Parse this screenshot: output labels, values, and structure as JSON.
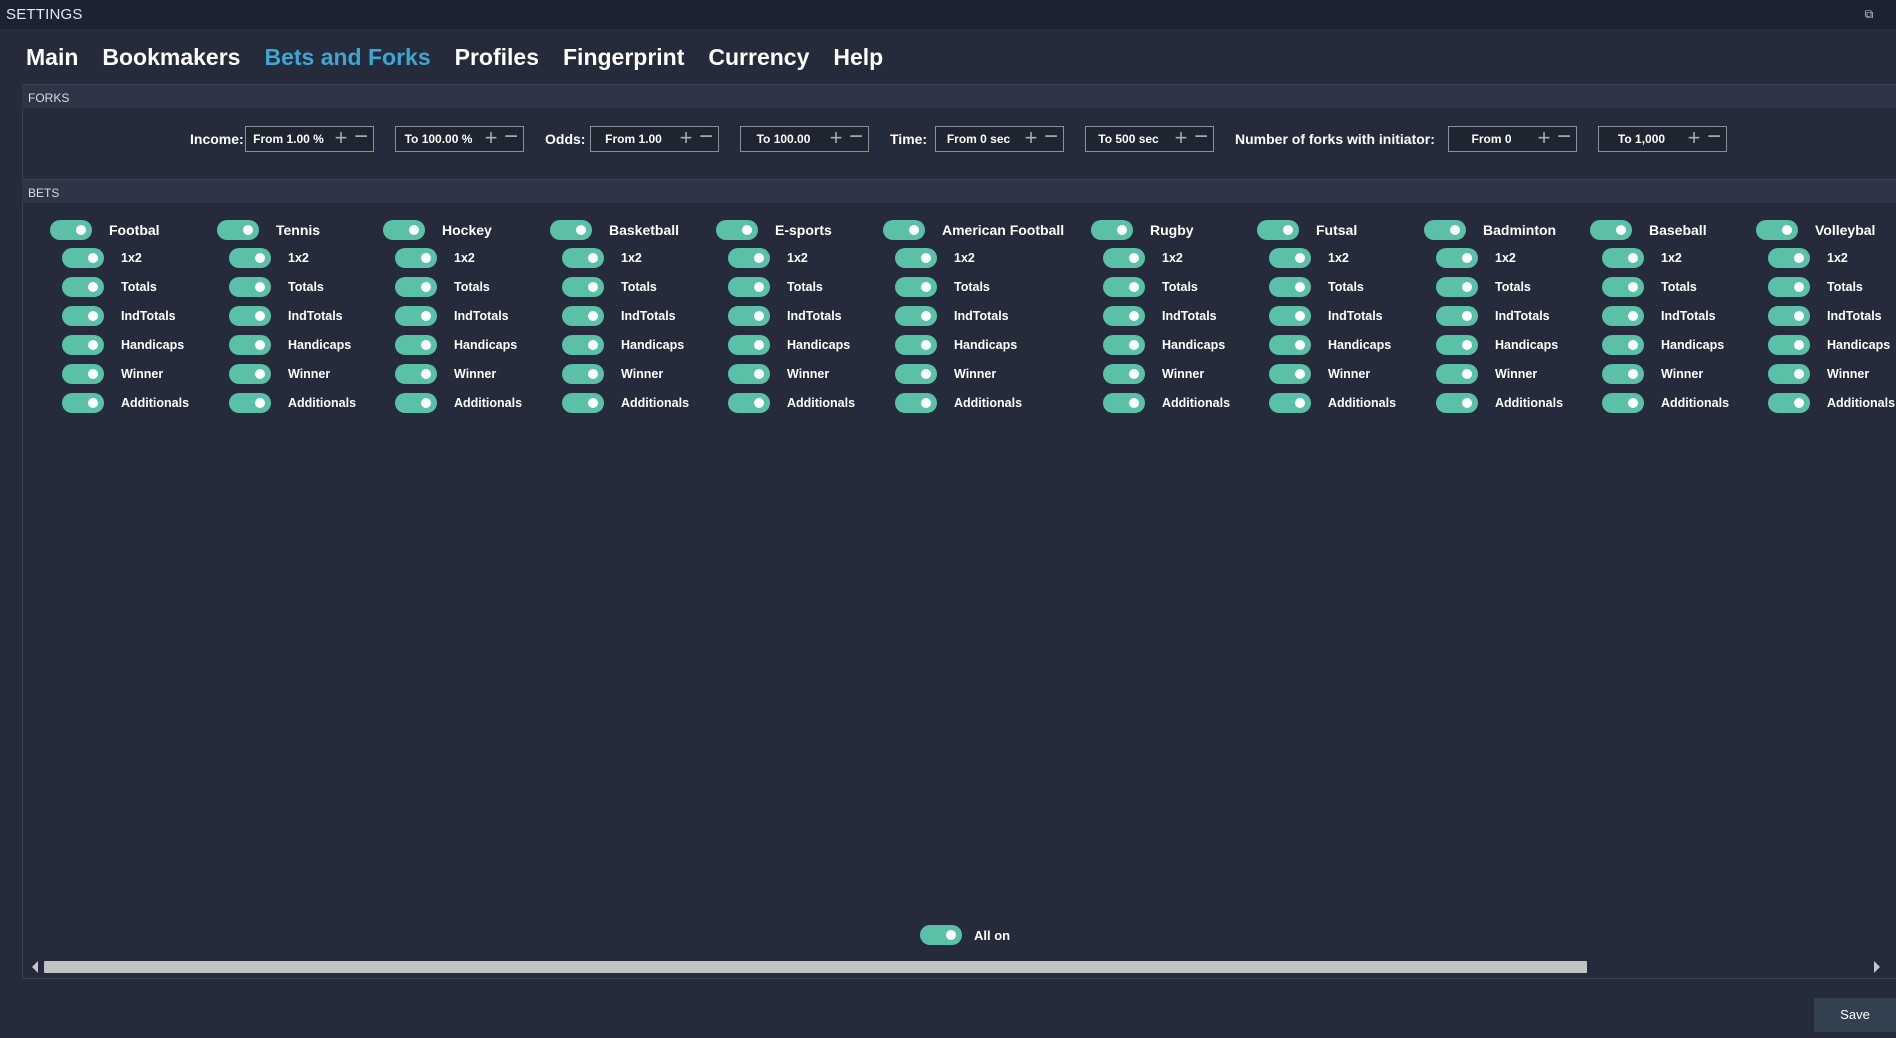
{
  "window": {
    "title": "SETTINGS"
  },
  "tabs": [
    {
      "label": "Main",
      "active": false
    },
    {
      "label": "Bookmakers",
      "active": false
    },
    {
      "label": "Bets and Forks",
      "active": true
    },
    {
      "label": "Profiles",
      "active": false
    },
    {
      "label": "Fingerprint",
      "active": false
    },
    {
      "label": "Currency",
      "active": false
    },
    {
      "label": "Help",
      "active": false
    }
  ],
  "forks": {
    "header": "FORKS",
    "income_label": "Income:",
    "income_from": "From 1.00 %",
    "income_to": "To 100.00 %",
    "odds_label": "Odds:",
    "odds_from": "From 1.00",
    "odds_to": "To 100.00",
    "time_label": "Time:",
    "time_from": "From 0 sec",
    "time_to": "To 500 sec",
    "initiator_label": "Number of forks with initiator:",
    "initiator_from": "From 0",
    "initiator_to": "To 1,000"
  },
  "bets": {
    "header": "BETS",
    "sports": [
      {
        "name": "Footbal",
        "on": true
      },
      {
        "name": "Tennis",
        "on": true
      },
      {
        "name": "Hockey",
        "on": true
      },
      {
        "name": "Basketball",
        "on": true
      },
      {
        "name": "E-sports",
        "on": true
      },
      {
        "name": "American Football",
        "on": true
      },
      {
        "name": "Rugby",
        "on": true
      },
      {
        "name": "Futsal",
        "on": true
      },
      {
        "name": "Badminton",
        "on": true
      },
      {
        "name": "Baseball",
        "on": true
      },
      {
        "name": "Volleybal",
        "on": true
      }
    ],
    "bet_types": [
      "1x2",
      "Totals",
      "IndTotals",
      "Handicaps",
      "Winner",
      "Additionals"
    ],
    "all_on_label": "All on"
  },
  "footer": {
    "save_label": "Save"
  },
  "colors": {
    "accent": "#3ea6d0",
    "toggle": "#5ac1a8",
    "background": "#252b3a"
  }
}
